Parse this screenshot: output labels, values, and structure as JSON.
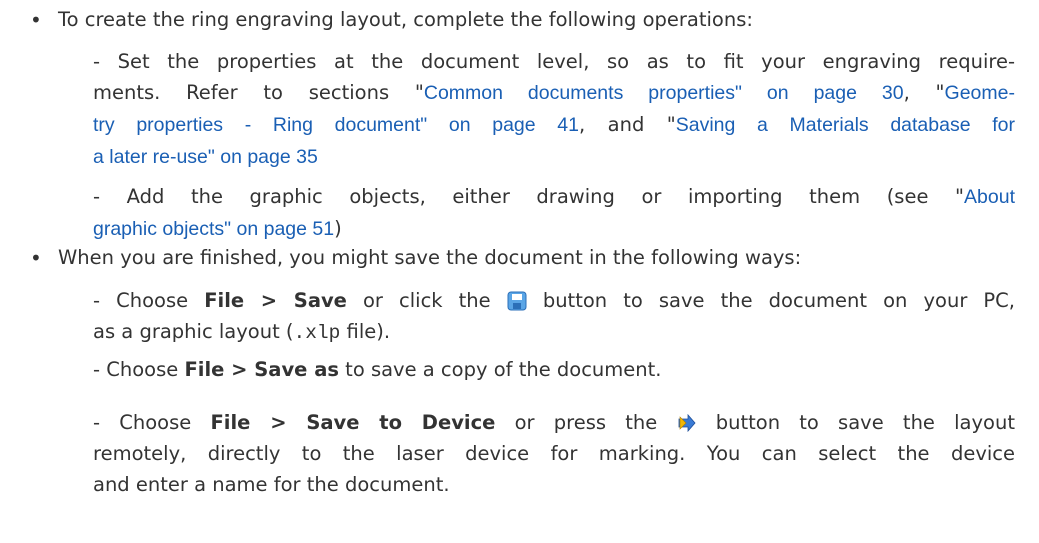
{
  "bullets": {
    "b1": "To create the ring engraving layout, complete the following operations:",
    "b2": "When you are finished, you might save the document in the following ways:"
  },
  "para1": {
    "l1": "- Set the properties at the document level, so as to fit your engraving require-",
    "l2_pre": "ments. Refer to sections \"",
    "l2_link1": "Common documents properties\" on page 30",
    "l2_mid": ", \"",
    "l2_link2": "Geome-",
    "l3_link2": "try properties - Ring document\" on page 41",
    "l3_mid": ", and \"",
    "l3_link3": "Saving a Materials database for",
    "l4_link3": "a later re-use\" on page 35"
  },
  "para2": {
    "l1_pre": "- Add the graphic objects, either drawing or importing them (see \"",
    "l1_link": "About",
    "l2_link": "graphic objects\" on page 51",
    "l2_post": ")"
  },
  "para3": {
    "l1_pre": "- Choose ",
    "l1_bold": "File > Save",
    "l1_mid": " or click the ",
    "l1_post": " button to save the document on your PC,",
    "l2_pre": "as a graphic layout (",
    "l2_code": ".xlp",
    "l2_post": " file)."
  },
  "para4": {
    "pre": "- Choose ",
    "bold": "File > Save as",
    "post": " to save a copy of the document."
  },
  "para5": {
    "l1_pre": "- Choose ",
    "l1_bold": "File > Save to Device",
    "l1_mid": " or press the ",
    "l1_post": " button to save the layout",
    "l2": "remotely, directly to the laser device for marking. You can select the device",
    "l3": "and enter a name for the document."
  },
  "icons": {
    "save": "save-floppy-icon",
    "device": "save-to-device-icon"
  }
}
